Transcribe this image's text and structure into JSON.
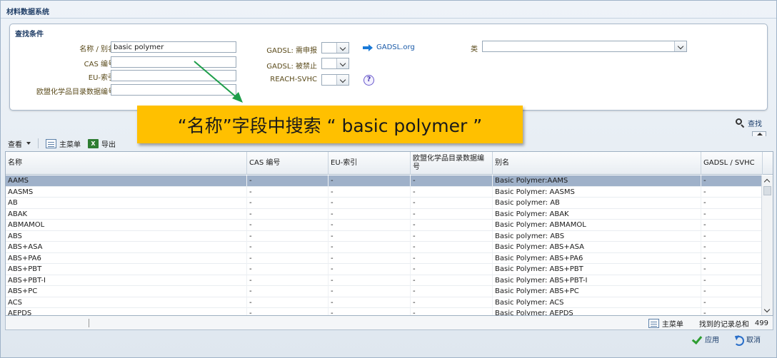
{
  "window": {
    "title": "材料数据系统"
  },
  "search": {
    "title": "查找条件",
    "name_label": "名称 / 别名",
    "name_value": "basic polymer",
    "cas_label": "CAS 编号",
    "cas_value": "",
    "eu_label": "EU-索引",
    "eu_value": "",
    "echa_label": "欧盟化学品目录数据编号",
    "echa_value": "",
    "gadsl_declare_label": "GADSL: 需申报",
    "gadsl_banned_label": "GADSL: 被禁止",
    "reach_label": "REACH-SVHC",
    "gadsl_link": "GADSL.org",
    "class_label": "类",
    "find_label": "查找"
  },
  "toolbar": {
    "view_label": "查看",
    "main_menu_label": "主菜单",
    "export_label": "导出"
  },
  "grid": {
    "columns": [
      "名称",
      "CAS 编号",
      "EU-索引",
      "欧盟化学品目录数据编号",
      "别名",
      "GADSL / SVHC"
    ],
    "rows": [
      [
        "AAMS",
        "-",
        "-",
        "-",
        "Basic Polymer:AAMS",
        "-"
      ],
      [
        "AASMS",
        "-",
        "-",
        "-",
        "Basic Polymer: AASMS",
        "-"
      ],
      [
        "AB",
        "-",
        "-",
        "-",
        "Basic polymer: AB",
        "-"
      ],
      [
        "ABAK",
        "-",
        "-",
        "-",
        "Basic Polymer: ABAK",
        "-"
      ],
      [
        "ABMAMOL",
        "-",
        "-",
        "-",
        "Basic Polymer: ABMAMOL",
        "-"
      ],
      [
        "ABS",
        "-",
        "-",
        "-",
        "Basic polymer: ABS",
        "-"
      ],
      [
        "ABS+ASA",
        "-",
        "-",
        "-",
        "Basic Polymer: ABS+ASA",
        "-"
      ],
      [
        "ABS+PA6",
        "-",
        "-",
        "-",
        "Basic Polymer: ABS+PA6",
        "-"
      ],
      [
        "ABS+PBT",
        "-",
        "-",
        "-",
        "Basic Polymer: ABS+PBT",
        "-"
      ],
      [
        "ABS+PBT-I",
        "-",
        "-",
        "-",
        "Basic Polymer: ABS+PBT-I",
        "-"
      ],
      [
        "ABS+PC",
        "-",
        "-",
        "-",
        "Basic Polymer: ABS+PC",
        "-"
      ],
      [
        "ACS",
        "-",
        "-",
        "-",
        "Basic Polymer: ACS",
        "-"
      ],
      [
        "AEPDS",
        "-",
        "-",
        "-",
        "Basic Polymer: AEPDS",
        "-"
      ]
    ]
  },
  "status": {
    "main_menu_label": "主菜单",
    "records_label": "找到的记录总和",
    "records_count": "499"
  },
  "footer": {
    "apply_label": "应用",
    "cancel_label": "取消"
  },
  "callout": {
    "text": "“名称”字段中搜索 “ basic polymer ”"
  },
  "colors": {
    "callout_bg": "#ffc000",
    "selected_row": "#9fb1c9",
    "pointer_arrow": "#1e9e4a",
    "link": "#1a5aa8"
  }
}
